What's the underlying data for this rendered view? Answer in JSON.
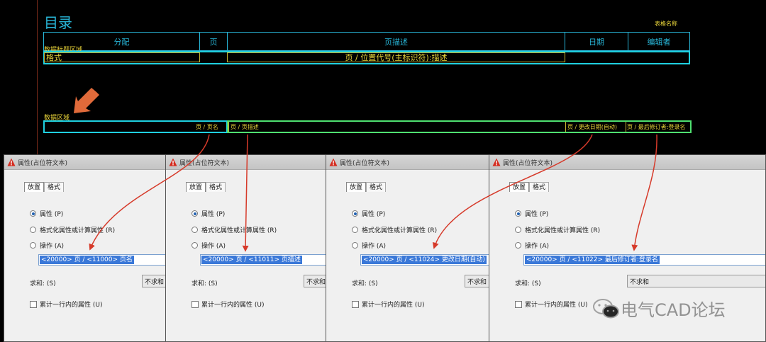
{
  "cad": {
    "title": "目录",
    "table_name_label": "表格名称",
    "header_cells": [
      "分配",
      "页",
      "页描述",
      "日期",
      "编辑者"
    ],
    "title_area_label": "数据标题区域",
    "format_label": "格式",
    "format_row_text": "页 / 位置代号(主标识符):描述",
    "data_area_label": "数据区域",
    "data_cells": [
      "页 / 页名",
      "页 / 页描述",
      "页 / 更改日期(自动)",
      "页 / 最后修订者:登录名"
    ]
  },
  "dialogs": [
    {
      "title": "属性(占位符文本)",
      "tabs": [
        "放置",
        "格式"
      ],
      "radio_options": [
        "属性 (P)",
        "格式化属性或计算属性 (R)",
        "操作 (A)"
      ],
      "selected_radio": 0,
      "expression": "<20000> 页 / <11000> 页名",
      "sum_label": "求和: (S)",
      "sum_value": "不求和",
      "accumulate_label": "累计一行内的属性 (U)"
    },
    {
      "title": "属性(占位符文本)",
      "tabs": [
        "放置",
        "格式"
      ],
      "radio_options": [
        "属性 (P)",
        "格式化属性或计算属性 (R)",
        "操作 (A)"
      ],
      "selected_radio": 0,
      "expression": "<20000> 页 / <11011> 页描述",
      "sum_label": "求和: (S)",
      "sum_value": "不求和",
      "accumulate_label": "累计一行内的属性 (U)"
    },
    {
      "title": "属性(占位符文本)",
      "tabs": [
        "放置",
        "格式"
      ],
      "radio_options": [
        "属性 (P)",
        "格式化属性或计算属性 (R)",
        "操作 (A)"
      ],
      "selected_radio": 0,
      "expression": "<20000> 页 / <11024> 更改日期(自动)",
      "sum_label": "求和: (S)",
      "sum_value": "不求和",
      "accumulate_label": "累计一行内的属性 (U)"
    },
    {
      "title": "属性(占位符文本)",
      "tabs": [
        "放置",
        "格式"
      ],
      "radio_options": [
        "属性 (P)",
        "格式化属性或计算属性 (R)",
        "操作 (A)"
      ],
      "selected_radio": 0,
      "expression": "<20000> 页 / <11022> 最后修订者:登录名",
      "sum_label": "求和: (S)",
      "sum_value": "不求和",
      "accumulate_label": "累计一行内的属性 (U)"
    }
  ],
  "watermark": {
    "text": "电气CAD论坛",
    "icon": "wechat-icon"
  },
  "colors": {
    "cyan": "#28b6d8",
    "yellow": "#e8d43a",
    "green": "#4fe070",
    "arrow_red": "#d63a2a",
    "orange_arrow": "#e06a3a",
    "selection": "#3a78d8"
  }
}
